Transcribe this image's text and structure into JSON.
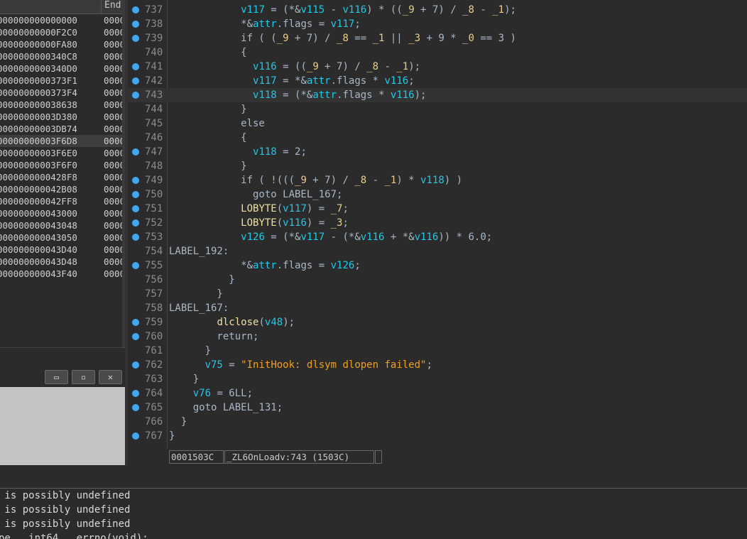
{
  "segments": {
    "header_end": "End",
    "rows": [
      {
        "addr": "000000000000000",
        "end": "0000"
      },
      {
        "addr": "00000000000F2C0",
        "end": "0000"
      },
      {
        "addr": "00000000000FA80",
        "end": "0000"
      },
      {
        "addr": "0000000000340C8",
        "end": "0000"
      },
      {
        "addr": "0000000000340D0",
        "end": "0000"
      },
      {
        "addr": "0000000000373F1",
        "end": "0000"
      },
      {
        "addr": "0000000000373F4",
        "end": "0000"
      },
      {
        "addr": "000000000038638",
        "end": "0000"
      },
      {
        "addr": "00000000003D380",
        "end": "0000"
      },
      {
        "addr": "00000000003DB74",
        "end": "0000"
      },
      {
        "addr": "00000000003F6D8",
        "end": "0000"
      },
      {
        "addr": "00000000003F6E0",
        "end": "0000"
      },
      {
        "addr": "00000000003F6F0",
        "end": "0000"
      },
      {
        "addr": "0000000000428F8",
        "end": "0000"
      },
      {
        "addr": "000000000042B08",
        "end": "0000"
      },
      {
        "addr": "000000000042FF8",
        "end": "0000"
      },
      {
        "addr": "000000000043000",
        "end": "0000"
      },
      {
        "addr": "000000000043048",
        "end": "0000"
      },
      {
        "addr": "000000000043050",
        "end": "0000"
      },
      {
        "addr": "000000000043D40",
        "end": "0000"
      },
      {
        "addr": "000000000043D48",
        "end": "0000"
      },
      {
        "addr": "000000000043F40",
        "end": "0000"
      }
    ],
    "selected_index": 10
  },
  "window_buttons": [
    "▭",
    "▫",
    "✕"
  ],
  "code": {
    "highlighted_line": "743",
    "lines": [
      {
        "n": "737",
        "bp": true,
        "parts": [
          [
            "p",
            "            "
          ],
          [
            "v",
            "v117"
          ],
          [
            "p",
            " = (*&"
          ],
          [
            "v",
            "v115"
          ],
          [
            "p",
            " - "
          ],
          [
            "v",
            "v116"
          ],
          [
            "p",
            ") * (("
          ],
          [
            "g",
            "_9"
          ],
          [
            "p",
            " + 7) / "
          ],
          [
            "g",
            "_8"
          ],
          [
            "p",
            " - "
          ],
          [
            "g",
            "_1"
          ],
          [
            "p",
            ");"
          ]
        ]
      },
      {
        "n": "738",
        "bp": true,
        "parts": [
          [
            "p",
            "            *&"
          ],
          [
            "v",
            "attr"
          ],
          [
            "p",
            ".flags = "
          ],
          [
            "v",
            "v117"
          ],
          [
            "p",
            ";"
          ]
        ]
      },
      {
        "n": "739",
        "bp": true,
        "parts": [
          [
            "p",
            "            if ( ("
          ],
          [
            "g",
            "_9"
          ],
          [
            "p",
            " + 7) / "
          ],
          [
            "g",
            "_8"
          ],
          [
            "p",
            " == "
          ],
          [
            "g",
            "_1"
          ],
          [
            "p",
            " || "
          ],
          [
            "g",
            "_3"
          ],
          [
            "p",
            " + 9 * "
          ],
          [
            "g",
            "_0"
          ],
          [
            "p",
            " == 3 )"
          ]
        ]
      },
      {
        "n": "740",
        "bp": false,
        "parts": [
          [
            "p",
            "            {"
          ]
        ]
      },
      {
        "n": "741",
        "bp": true,
        "parts": [
          [
            "p",
            "              "
          ],
          [
            "v",
            "v116"
          ],
          [
            "p",
            " = (("
          ],
          [
            "g",
            "_9"
          ],
          [
            "p",
            " + 7) / "
          ],
          [
            "g",
            "_8"
          ],
          [
            "p",
            " - "
          ],
          [
            "g",
            "_1"
          ],
          [
            "p",
            ");"
          ]
        ]
      },
      {
        "n": "742",
        "bp": true,
        "parts": [
          [
            "p",
            "              "
          ],
          [
            "v",
            "v117"
          ],
          [
            "p",
            " = *&"
          ],
          [
            "v",
            "attr"
          ],
          [
            "p",
            ".flags * "
          ],
          [
            "v",
            "v116"
          ],
          [
            "p",
            ";"
          ]
        ]
      },
      {
        "n": "743",
        "bp": true,
        "parts": [
          [
            "p",
            "              "
          ],
          [
            "v",
            "v118"
          ],
          [
            "p",
            " = (*&"
          ],
          [
            "v",
            "attr"
          ],
          [
            "p",
            ".flags * "
          ],
          [
            "v",
            "v116"
          ],
          [
            "p",
            ");"
          ]
        ]
      },
      {
        "n": "744",
        "bp": false,
        "parts": [
          [
            "p",
            "            }"
          ]
        ]
      },
      {
        "n": "745",
        "bp": false,
        "parts": [
          [
            "p",
            "            else"
          ]
        ]
      },
      {
        "n": "746",
        "bp": false,
        "parts": [
          [
            "p",
            "            {"
          ]
        ]
      },
      {
        "n": "747",
        "bp": true,
        "parts": [
          [
            "p",
            "              "
          ],
          [
            "v",
            "v118"
          ],
          [
            "p",
            " = 2;"
          ]
        ]
      },
      {
        "n": "748",
        "bp": false,
        "parts": [
          [
            "p",
            "            }"
          ]
        ]
      },
      {
        "n": "749",
        "bp": true,
        "parts": [
          [
            "p",
            "            if ( !((("
          ],
          [
            "g",
            "_9"
          ],
          [
            "p",
            " + 7) / "
          ],
          [
            "g",
            "_8"
          ],
          [
            "p",
            " - "
          ],
          [
            "g",
            "_1"
          ],
          [
            "p",
            ") * "
          ],
          [
            "v",
            "v118"
          ],
          [
            "p",
            ") )"
          ]
        ]
      },
      {
        "n": "750",
        "bp": true,
        "parts": [
          [
            "p",
            "              goto LABEL_167;"
          ]
        ]
      },
      {
        "n": "751",
        "bp": true,
        "parts": [
          [
            "p",
            "            "
          ],
          [
            "f",
            "LOBYTE"
          ],
          [
            "p",
            "("
          ],
          [
            "v",
            "v117"
          ],
          [
            "p",
            ") = "
          ],
          [
            "g",
            "_7"
          ],
          [
            "p",
            ";"
          ]
        ]
      },
      {
        "n": "752",
        "bp": true,
        "parts": [
          [
            "p",
            "            "
          ],
          [
            "f",
            "LOBYTE"
          ],
          [
            "p",
            "("
          ],
          [
            "v",
            "v116"
          ],
          [
            "p",
            ") = "
          ],
          [
            "g",
            "_3"
          ],
          [
            "p",
            ";"
          ]
        ]
      },
      {
        "n": "753",
        "bp": true,
        "parts": [
          [
            "p",
            "            "
          ],
          [
            "v",
            "v126"
          ],
          [
            "p",
            " = (*&"
          ],
          [
            "v",
            "v117"
          ],
          [
            "p",
            " - (*&"
          ],
          [
            "v",
            "v116"
          ],
          [
            "p",
            " + *&"
          ],
          [
            "v",
            "v116"
          ],
          [
            "p",
            ")) * 6.0;"
          ]
        ]
      },
      {
        "n": "754",
        "bp": false,
        "parts": [
          [
            "p",
            "LABEL_192:"
          ]
        ]
      },
      {
        "n": "755",
        "bp": true,
        "parts": [
          [
            "p",
            "            *&"
          ],
          [
            "v",
            "attr"
          ],
          [
            "p",
            ".flags = "
          ],
          [
            "v",
            "v126"
          ],
          [
            "p",
            ";"
          ]
        ]
      },
      {
        "n": "756",
        "bp": false,
        "parts": [
          [
            "p",
            "          }"
          ]
        ]
      },
      {
        "n": "757",
        "bp": false,
        "parts": [
          [
            "p",
            "        }"
          ]
        ]
      },
      {
        "n": "758",
        "bp": false,
        "parts": [
          [
            "p",
            "LABEL_167:"
          ]
        ]
      },
      {
        "n": "759",
        "bp": true,
        "parts": [
          [
            "p",
            "        "
          ],
          [
            "f",
            "dlclose"
          ],
          [
            "p",
            "("
          ],
          [
            "v",
            "v48"
          ],
          [
            "p",
            ");"
          ]
        ]
      },
      {
        "n": "760",
        "bp": true,
        "parts": [
          [
            "p",
            "        return;"
          ]
        ]
      },
      {
        "n": "761",
        "bp": false,
        "parts": [
          [
            "p",
            "      }"
          ]
        ]
      },
      {
        "n": "762",
        "bp": true,
        "parts": [
          [
            "p",
            "      "
          ],
          [
            "v",
            "v75"
          ],
          [
            "p",
            " = "
          ],
          [
            "s",
            "\"InitHook: dlsym dlopen failed\""
          ],
          [
            "p",
            ";"
          ]
        ]
      },
      {
        "n": "763",
        "bp": false,
        "parts": [
          [
            "p",
            "    }"
          ]
        ]
      },
      {
        "n": "764",
        "bp": true,
        "parts": [
          [
            "p",
            "    "
          ],
          [
            "v",
            "v76"
          ],
          [
            "p",
            " = 6LL;"
          ]
        ]
      },
      {
        "n": "765",
        "bp": true,
        "parts": [
          [
            "p",
            "    goto LABEL_131;"
          ]
        ]
      },
      {
        "n": "766",
        "bp": false,
        "parts": [
          [
            "p",
            "  }"
          ]
        ]
      },
      {
        "n": "767",
        "bp": true,
        "parts": [
          [
            "p",
            "}"
          ]
        ]
      }
    ]
  },
  "status": {
    "offset": "0001503C",
    "location": "_ZL6OnLoadv:743 (1503C)"
  },
  "output": {
    "lines": [
      " is possibly undefined",
      " is possibly undefined",
      " is possibly undefined",
      "pe   int64   errno(void);"
    ]
  }
}
